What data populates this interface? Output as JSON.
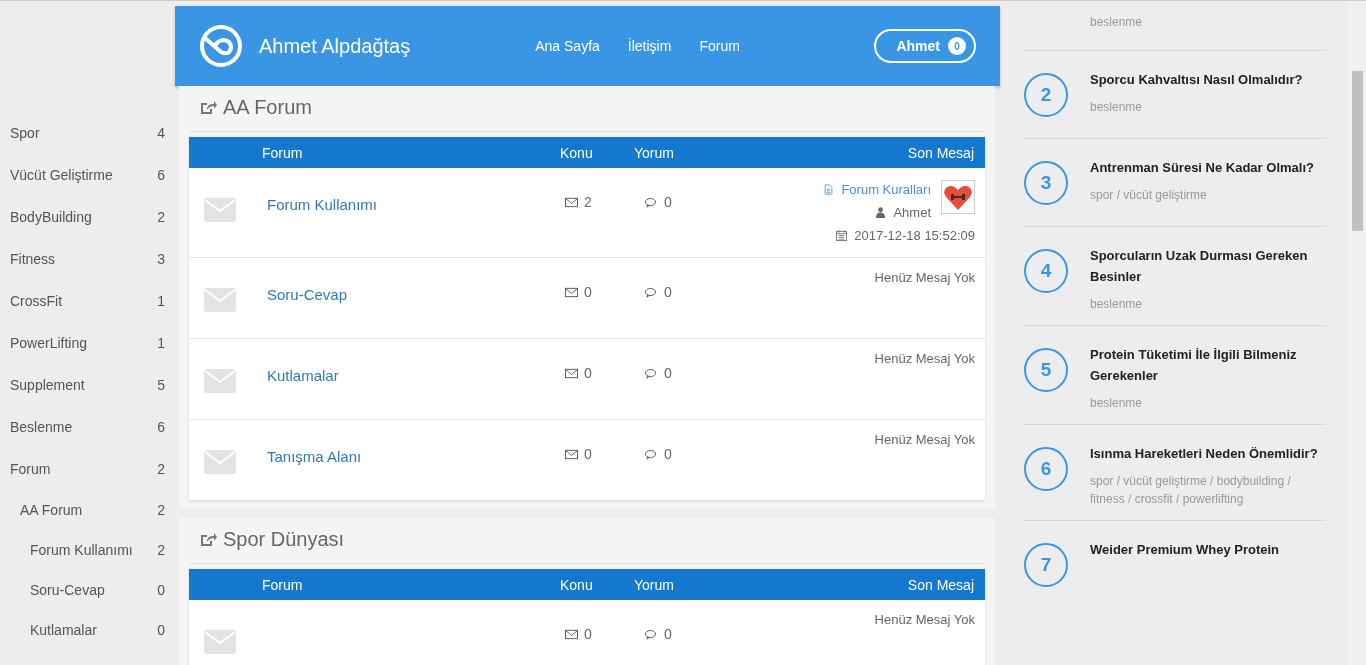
{
  "sidebar": {
    "items": [
      {
        "label": "Spor",
        "count": "4"
      },
      {
        "label": "Vücüt Geliştirme",
        "count": "6"
      },
      {
        "label": "BodyBuilding",
        "count": "2"
      },
      {
        "label": "Fitness",
        "count": "3"
      },
      {
        "label": "CrossFit",
        "count": "1"
      },
      {
        "label": "PowerLifting",
        "count": "1"
      },
      {
        "label": "Supplement",
        "count": "5"
      },
      {
        "label": "Beslenme",
        "count": "6"
      },
      {
        "label": "Forum",
        "count": "2",
        "children": [
          {
            "label": "AA Forum",
            "count": "2",
            "children": [
              {
                "label": "Forum Kullanımı",
                "count": "2"
              },
              {
                "label": "Soru-Cevap",
                "count": "0"
              },
              {
                "label": "Kutlamalar",
                "count": "0"
              }
            ]
          }
        ]
      }
    ]
  },
  "header": {
    "title": "Ahmet Alpdağtaş",
    "nav": [
      "Ana Sayfa",
      "İletişim",
      "Forum"
    ],
    "user": {
      "name": "Ahmet",
      "badge": "0"
    }
  },
  "sections": [
    {
      "title": "AA Forum",
      "columns": [
        "Forum",
        "Konu",
        "Yorum",
        "Son Mesaj"
      ],
      "rows": [
        {
          "name": "Forum Kullanımı",
          "topics": "2",
          "comments": "0",
          "last": {
            "kind": "message",
            "link": "Forum Kuralları",
            "user": "Ahmet",
            "date": "2017-12-18 15:52:09"
          }
        },
        {
          "name": "Soru-Cevap",
          "topics": "0",
          "comments": "0",
          "last": {
            "kind": "none",
            "text": "Henüz Mesaj Yok"
          }
        },
        {
          "name": "Kutlamalar",
          "topics": "0",
          "comments": "0",
          "last": {
            "kind": "none",
            "text": "Henüz Mesaj Yok"
          }
        },
        {
          "name": "Tanışma Alanı",
          "topics": "0",
          "comments": "0",
          "last": {
            "kind": "none",
            "text": "Henüz Mesaj Yok"
          }
        }
      ]
    },
    {
      "title": "Spor Dünyası",
      "columns": [
        "Forum",
        "Konu",
        "Yorum",
        "Son Mesaj"
      ],
      "rows": [
        {
          "topics": "0",
          "comments": "0",
          "last": {
            "kind": "none",
            "text": "Henüz Mesaj Yok"
          }
        }
      ]
    }
  ],
  "popular": [
    {
      "category": "beslenme"
    },
    {
      "number": "2",
      "title": "Sporcu Kahvaltısı Nasıl Olmalıdır?",
      "category": "beslenme"
    },
    {
      "number": "3",
      "title": "Antrenman Süresi Ne Kadar Olmalı?",
      "category": "spor / vücüt geliştirme"
    },
    {
      "number": "4",
      "title": "Sporcuların Uzak Durması Gereken Besinler",
      "category": "beslenme"
    },
    {
      "number": "5",
      "title": "Protein Tüketimi İle İlgili Bilmeniz Gerekenler",
      "category": "beslenme"
    },
    {
      "number": "6",
      "title": "Isınma Hareketleri Neden Önemlidir?",
      "category": "spor / vücüt geliştirme / bodybuilding / fitness / crossfit / powerlifting"
    },
    {
      "number": "7",
      "title": "Weider Premium Whey Protein"
    }
  ]
}
